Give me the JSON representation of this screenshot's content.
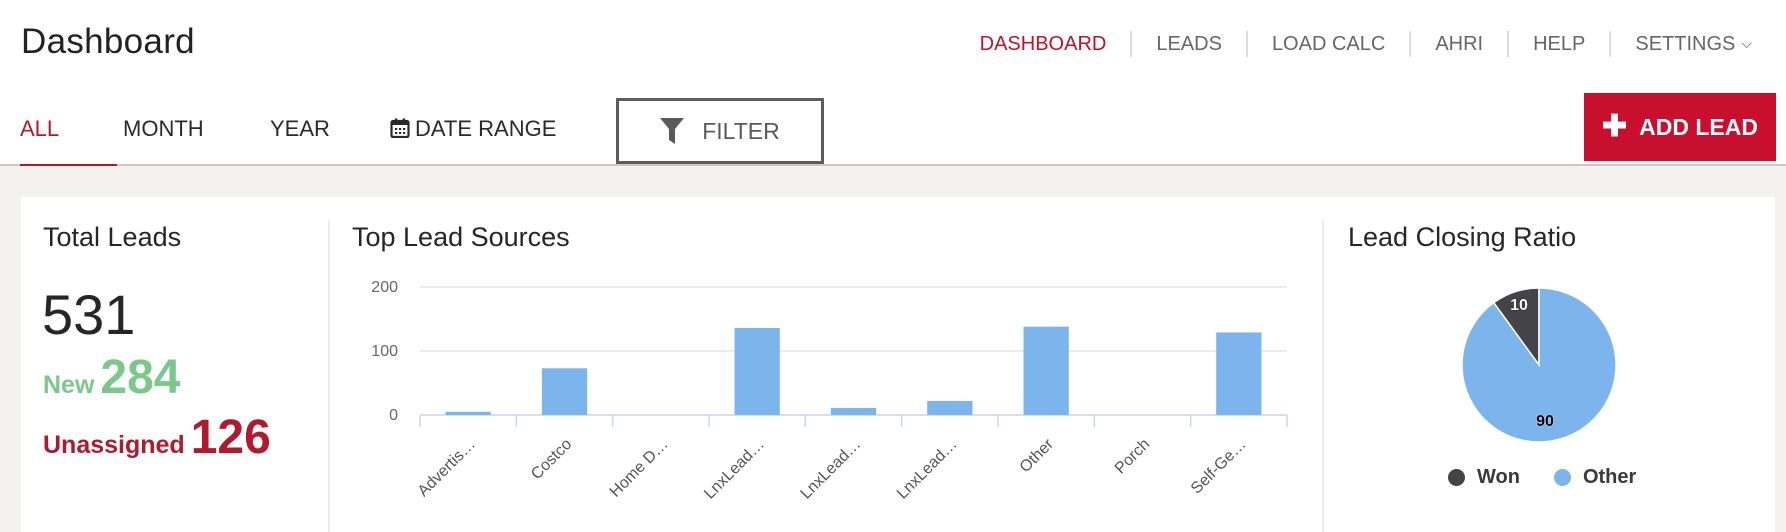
{
  "header": {
    "title": "Dashboard",
    "nav": [
      {
        "label": "DASHBOARD",
        "active": true
      },
      {
        "label": "LEADS",
        "active": false
      },
      {
        "label": "LOAD CALC",
        "active": false
      },
      {
        "label": "AHRI",
        "active": false
      },
      {
        "label": "HELP",
        "active": false
      },
      {
        "label": "SETTINGS",
        "active": false,
        "icon": "chevron-down-icon"
      }
    ]
  },
  "tabs": [
    {
      "label": "ALL",
      "active": true
    },
    {
      "label": "MONTH",
      "active": false
    },
    {
      "label": "YEAR",
      "active": false
    },
    {
      "label": "DATE RANGE",
      "active": false,
      "icon": "calendar-icon"
    }
  ],
  "toolbar": {
    "filter_label": "FILTER",
    "filter_icon": "funnel-icon",
    "add_lead_label": "ADD LEAD",
    "add_lead_icon": "plus-icon"
  },
  "colors": {
    "accent": "#c8102e",
    "tab_active": "#b11a2e",
    "new_green": "#7cc88a",
    "unassigned_red": "#b11a2e",
    "bar_blue": "#7cb5ec",
    "won_dark": "#434348",
    "background": "#f4f1ee"
  },
  "total_leads": {
    "title": "Total Leads",
    "total": "531",
    "new_label": "New",
    "new_value": "284",
    "unassigned_label": "Unassigned",
    "unassigned_value": "126"
  },
  "chart_data": [
    {
      "type": "bar",
      "title": "Top Lead Sources",
      "xlabel": "",
      "ylabel": "",
      "categories": [
        "Advertis…",
        "Costco",
        "Home D…",
        "LnxLead…",
        "LnxLead…",
        "LnxLead…",
        "Other",
        "Porch",
        "Self-Ge…"
      ],
      "values": [
        5,
        73,
        0,
        136,
        11,
        22,
        138,
        0,
        129
      ],
      "yticks": [
        0,
        100,
        200
      ],
      "ylim": [
        0,
        200
      ],
      "grid": true,
      "color": "#7cb5ec"
    },
    {
      "type": "pie",
      "title": "Lead Closing Ratio",
      "labels": [
        "Won",
        "Other"
      ],
      "values": [
        10,
        90
      ],
      "colors": [
        "#434348",
        "#7cb5ec"
      ],
      "legend": "bottom"
    }
  ]
}
